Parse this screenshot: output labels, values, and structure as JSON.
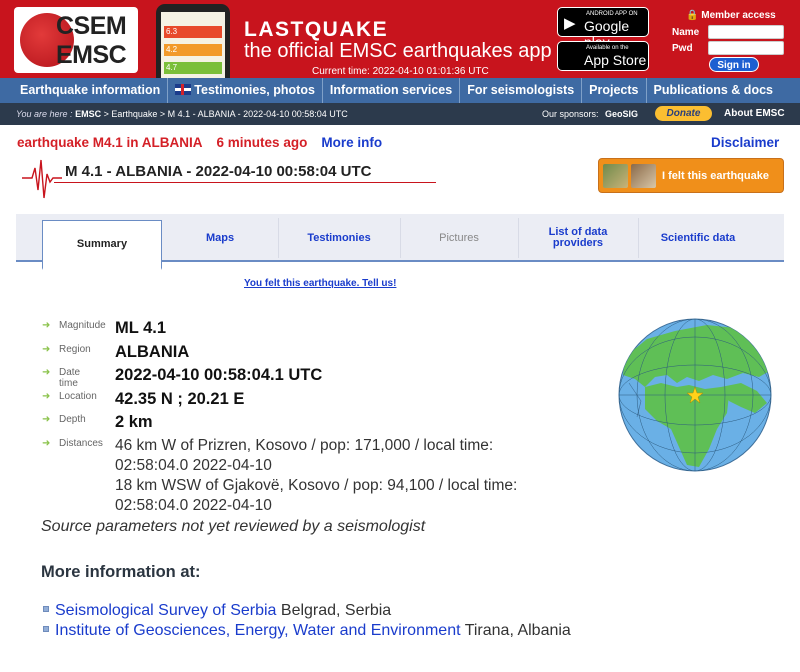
{
  "header": {
    "logo_line1": "CSEM",
    "logo_line2": "EMSC",
    "app_title": "LASTQUAKE",
    "app_subtitle": "the official EMSC earthquakes app",
    "current_time": "Current time: 2022-04-10 01:01:36 UTC",
    "google_small": "ANDROID APP ON",
    "google_big": "Google play",
    "apple_small": "Available on the",
    "apple_big": "App Store",
    "member_access": "Member access",
    "name_label": "Name",
    "pwd_label": "Pwd",
    "signin_label": "Sign in",
    "phone_rows": [
      "6.3",
      "4.2",
      "4.7"
    ]
  },
  "nav": {
    "items": [
      "Earthquake information",
      "Testimonies, photos",
      "Information services",
      "For seismologists",
      "Projects",
      "Publications & docs"
    ]
  },
  "breadcrumb": {
    "prefix": "You are here :",
    "emsc": "EMSC",
    "trail": "> Earthquake > M 4.1 - ALBANIA - 2022-04-10 00:58:04 UTC",
    "sponsor_label": "Our sponsors:",
    "sponsor_name": "GeoSIG",
    "donate": "Donate",
    "about": "About EMSC"
  },
  "event": {
    "headline": "earthquake M4.1 in ALBANIA",
    "ago": "6 minutes ago",
    "more_info": "More info",
    "disclaimer": "Disclaimer",
    "title": "M 4.1 - ALBANIA - 2022-04-10 00:58:04 UTC",
    "felt_button": "I felt this earthquake"
  },
  "tabs": [
    "Summary",
    "Maps",
    "Testimonies",
    "Pictures",
    "List of data providers",
    "Scientific data"
  ],
  "tell_us": "You felt this earthquake. Tell us!",
  "details": {
    "magnitude_label": "Magnitude",
    "magnitude": "ML 4.1",
    "region_label": "Region",
    "region": "ALBANIA",
    "date_label": "Date time",
    "date": "2022-04-10 00:58:04.1 UTC",
    "location_label": "Location",
    "location": "42.35 N ; 20.21 E",
    "depth_label": "Depth",
    "depth": "2 km",
    "distances_label": "Distances",
    "distances": [
      "46 km W of Prizren, Kosovo / pop: 171,000 / local time:",
      "02:58:04.0 2022-04-10",
      "18 km WSW of Gjakovë, Kosovo / pop: 94,100 / local time:",
      "02:58:04.0 2022-04-10"
    ],
    "review_note": "Source parameters not yet reviewed by a seismologist"
  },
  "more_info": {
    "heading": "More information at:",
    "links": [
      {
        "name": "Seismological Survey of Serbia",
        "place": "Belgrad, Serbia"
      },
      {
        "name": "Institute of Geosciences, Energy, Water and Environment",
        "place": "Tirana, Albania"
      }
    ]
  },
  "colors": {
    "header_red": "#c8141d",
    "nav_blue": "#3e6aa3",
    "link_blue": "#1a3ccc",
    "accent_red": "#d42027",
    "felt_orange": "#f08f1a"
  }
}
